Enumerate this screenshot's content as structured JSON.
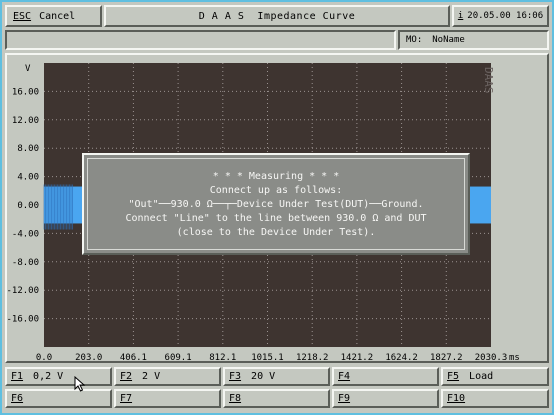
{
  "header": {
    "esc_key": "ESC",
    "esc_label": "Cancel",
    "title": "D A A S  Impedance Curve",
    "info_key": "i",
    "clock": "20.05.00 16:06"
  },
  "status": {
    "message": "",
    "mo_label": "MO:",
    "mo_value": "NoName"
  },
  "watermark": "DAAS",
  "colors": {
    "plot_bg": "#3e3430",
    "grid": "#9a9290",
    "signal": "#4aa6f0",
    "dialog_bg": "#8a8c88",
    "frame": "#5fbfe0"
  },
  "chart_data": {
    "type": "line",
    "ylabel": "V",
    "xlabel": "ms",
    "y_ticks": [
      "16.00",
      "12.00",
      "8.00",
      "4.00",
      "0.00",
      "-4.00",
      "-8.00",
      "-12.00",
      "-16.00"
    ],
    "x_ticks": [
      "0.0",
      "203.0",
      "406.1",
      "609.1",
      "812.1",
      "1015.1",
      "1218.2",
      "1421.2",
      "1624.2",
      "1827.2",
      "2030.3"
    ],
    "xlim": [
      0,
      2030.3
    ],
    "ylim": [
      -20,
      20
    ],
    "grid": true,
    "series": [
      {
        "x_start": 0,
        "x_end": 2030.3,
        "amplitude": 2.6
      }
    ]
  },
  "dialog": {
    "lines": [
      "* * * Measuring * * *",
      "Connect up as follows:",
      "\"Out\"──930.0 Ω──┬─Device Under Test(DUT)──Ground.",
      "Connect \"Line\" to the line between 930.0 Ω and DUT",
      "(close to the Device Under Test)."
    ]
  },
  "fkeys": [
    {
      "key": "F1",
      "label": "0,2 V"
    },
    {
      "key": "F2",
      "label": "2 V"
    },
    {
      "key": "F3",
      "label": "20 V"
    },
    {
      "key": "F4",
      "label": ""
    },
    {
      "key": "F5",
      "label": "Load"
    },
    {
      "key": "F6",
      "label": ""
    },
    {
      "key": "F7",
      "label": ""
    },
    {
      "key": "F8",
      "label": ""
    },
    {
      "key": "F9",
      "label": ""
    },
    {
      "key": "F10",
      "label": ""
    }
  ]
}
